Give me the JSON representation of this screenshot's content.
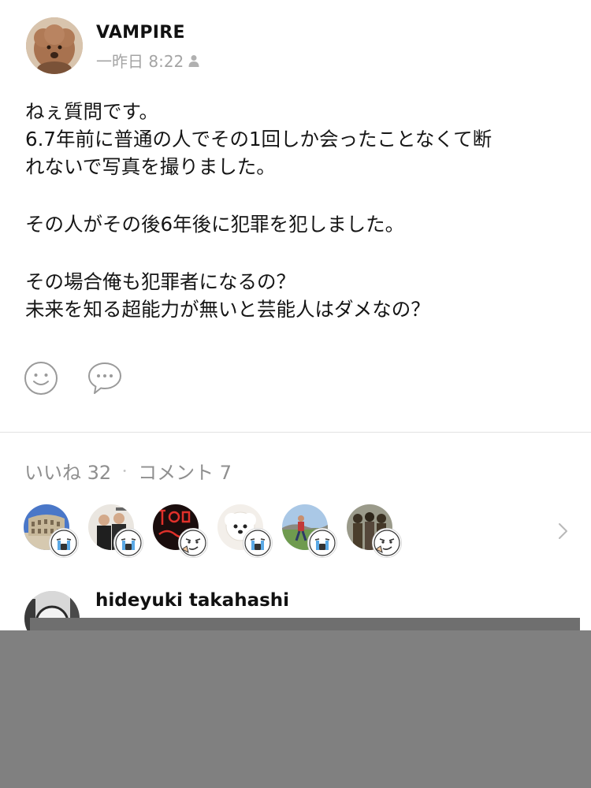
{
  "post": {
    "author": "VAMPIRE",
    "timestamp": "一昨日 8:22",
    "visibility_icon": "person-icon",
    "body": {
      "line1": "ねぇ質問です。",
      "line2": "6.7年前に普通の人でその1回しか会ったことなくて断",
      "line3": "れないで写真を撮りました。",
      "line4": "その人がその後6年後に犯罪を犯しました。",
      "line5": "その場合俺も犯罪者になるの？",
      "line6": "未来を知る超能力が無いと芸能人はダメなの？"
    },
    "actions": [
      {
        "icon": "smiley-icon"
      },
      {
        "icon": "comment-bubble-icon"
      }
    ]
  },
  "stats": {
    "likes_label": "いいね 32",
    "separator": "・",
    "comments_label": "コメント 7"
  },
  "reactors": [
    {
      "avatar": "colosseum-photo",
      "sticker": "crying-face-icon"
    },
    {
      "avatar": "two-men-photo",
      "sticker": "crying-face-icon"
    },
    {
      "avatar": "red-neon-photo",
      "sticker": "smirk-face-icon"
    },
    {
      "avatar": "white-dog-photo",
      "sticker": "crying-face-icon"
    },
    {
      "avatar": "outdoor-person-photo",
      "sticker": "crying-face-icon"
    },
    {
      "avatar": "group-photo",
      "sticker": "smirk-face-icon"
    }
  ],
  "comment": {
    "author": "hideyuki takahashi"
  },
  "colors": {
    "text_primary": "#111111",
    "text_secondary": "#a4a4a4",
    "divider": "#e2e2e2",
    "overlay": "#808080"
  }
}
